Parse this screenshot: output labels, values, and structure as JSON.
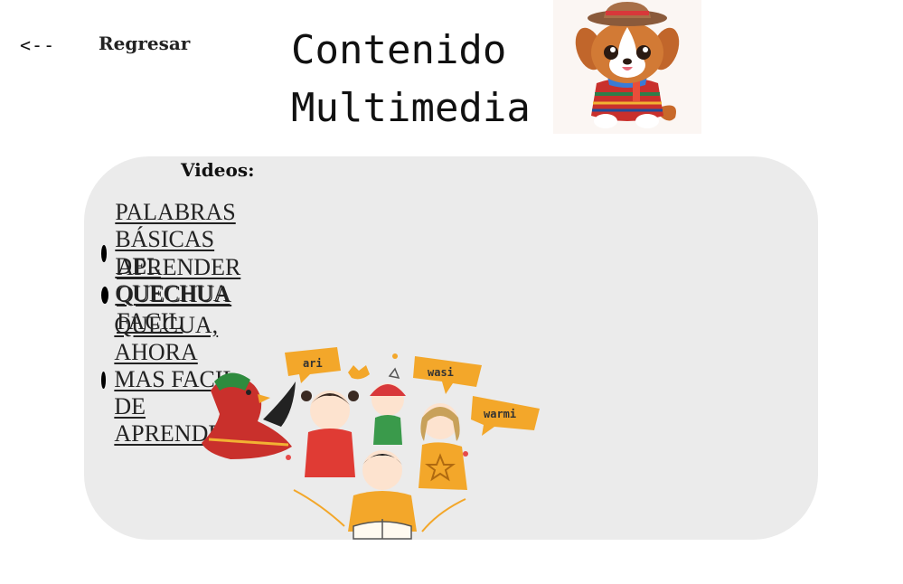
{
  "nav": {
    "back_arrow": "<--",
    "back_label": "Regresar"
  },
  "header": {
    "title_line1": "Contenido",
    "title_line2": "Multimedia"
  },
  "videos": {
    "heading": "Videos:",
    "items": [
      {
        "label": "PALABRAS BÁSICAS DEL QUECHUA"
      },
      {
        "label": "APRENDER QUECHUA FACIL"
      },
      {
        "label": "QUECUA, AHORA MAS FACIL DE APRENDER"
      }
    ]
  },
  "illustration": {
    "bubbles": [
      "ari",
      "wasi",
      "warmi"
    ]
  },
  "colors": {
    "card_background": "#ebebeb",
    "bubble_orange": "#f3a72a",
    "text": "#111111"
  },
  "icons": {
    "mascot": "mascot-dog-image",
    "bullet": "bullet-icon"
  }
}
